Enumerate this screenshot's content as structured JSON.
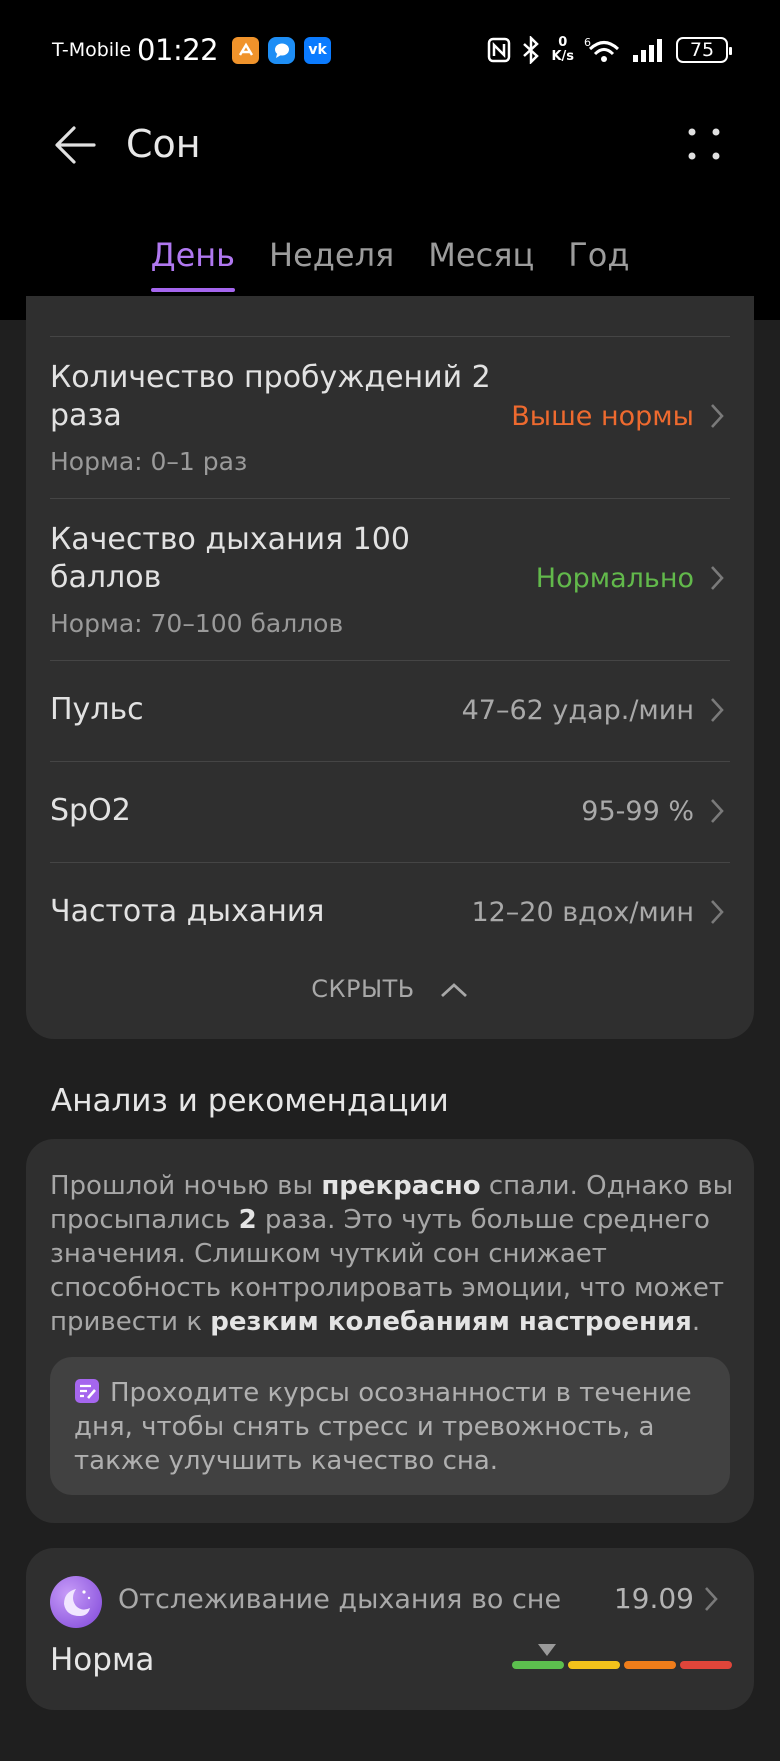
{
  "status_bar": {
    "carrier": "T-Mobile",
    "time": "01:22",
    "speed_value": "0",
    "speed_unit": "K/s",
    "network": "6",
    "battery": "75"
  },
  "header": {
    "title": "Сон",
    "tabs": [
      {
        "label": "День",
        "active": true
      },
      {
        "label": "Неделя",
        "active": false
      },
      {
        "label": "Месяц",
        "active": false
      },
      {
        "label": "Год",
        "active": false
      }
    ]
  },
  "metrics": [
    {
      "title": "Количество пробуждений  2",
      "title2": "раза",
      "sub": "Норма: 0–1 раз",
      "status": "Выше нормы",
      "status_color": "#ee6a2f"
    },
    {
      "title": "Качество дыхания  100",
      "title2": "баллов",
      "sub": "Норма: 70–100 баллов",
      "status": "Нормально",
      "status_color": "#62b94b"
    },
    {
      "title": "Пульс",
      "value": "47–62 удар./мин"
    },
    {
      "title": "SpO2",
      "value": "95-99 %"
    },
    {
      "title": "Частота дыхания",
      "value": "12–20 вдох/мин"
    }
  ],
  "hide_label": "СКРЫТЬ",
  "analysis": {
    "section_title": "Анализ и рекомендации",
    "p1": "Прошлой ночью вы ",
    "b1": "прекрасно",
    "p2": " спали. Однако вы просыпались ",
    "b2": "2",
    "p3": " раза. Это чуть больше среднего значения. Слишком чуткий сон снижает способность контролировать эмоции, что может привести к ",
    "b3": "резким колебаниям настроения",
    "p4": ".",
    "tip": "Проходите курсы осознанности в течение дня, чтобы снять стресс и тревожность, а также улучшить качество сна."
  },
  "tracking": {
    "label": "Отслеживание дыхания во сне",
    "date": "19.09",
    "status": "Норма",
    "scale_colors": [
      "#5cbf4e",
      "#f3c21b",
      "#ef7d1a",
      "#e0453a"
    ],
    "accent": "#a566ee"
  }
}
